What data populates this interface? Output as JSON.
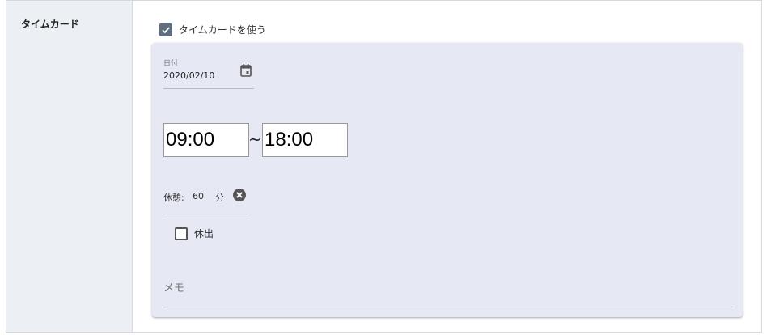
{
  "section": {
    "label": "タイムカード"
  },
  "use_timecard": {
    "label": "タイムカードを使う",
    "checked": true
  },
  "date": {
    "caption": "日付",
    "value": "2020/02/10",
    "icon": "calendar-icon"
  },
  "time": {
    "start": "09:00",
    "separator": "~",
    "end": "18:00"
  },
  "break": {
    "label": "休憩:",
    "value": "60",
    "unit": "分",
    "clear_icon": "close-circle-icon"
  },
  "holiday": {
    "label": "休出",
    "checked": false
  },
  "memo": {
    "placeholder": "メモ",
    "value": ""
  },
  "colors": {
    "card_bg": "#e6e8f4",
    "label_col_bg": "#eceff3",
    "checkbox_checked": "#5e6f80"
  }
}
